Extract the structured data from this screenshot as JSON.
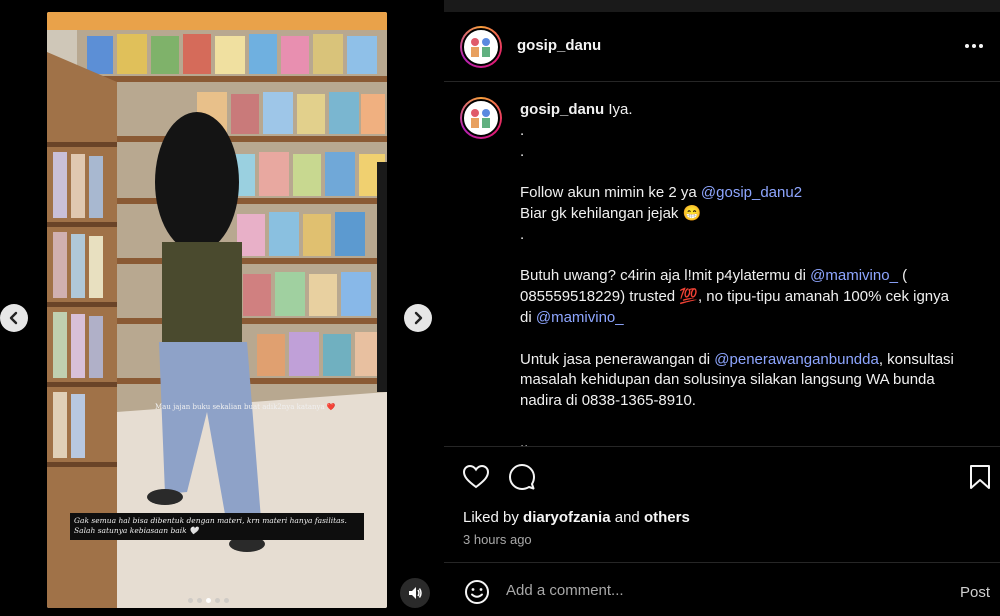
{
  "post": {
    "username": "gosip_danu",
    "more_icon": "more-horizontal-icon",
    "caption": {
      "username": "gosip_danu",
      "lines": [
        {
          "parts": [
            {
              "text": " Iya."
            }
          ]
        },
        {
          "parts": [
            {
              "text": "."
            }
          ]
        },
        {
          "parts": [
            {
              "text": "."
            }
          ]
        },
        {
          "parts": [
            {
              "text": ""
            }
          ]
        },
        {
          "parts": [
            {
              "text": "Follow akun mimin ke 2 ya "
            },
            {
              "text": "@gosip_danu2",
              "mention": true
            }
          ]
        },
        {
          "parts": [
            {
              "text": "Biar gk kehilangan jejak 😁"
            }
          ]
        },
        {
          "parts": [
            {
              "text": "."
            }
          ]
        },
        {
          "parts": [
            {
              "text": ""
            }
          ]
        },
        {
          "parts": [
            {
              "text": "Butuh uwang? c4irin aja l!mit p4ylatermu di "
            },
            {
              "text": "@mamivino_",
              "mention": true
            },
            {
              "text": " ("
            }
          ]
        },
        {
          "parts": [
            {
              "text": "085559518229) trusted 💯, no tipu-tipu amanah 100% cek ignya"
            }
          ]
        },
        {
          "parts": [
            {
              "text": "di "
            },
            {
              "text": "@mamivino_",
              "mention": true
            }
          ]
        },
        {
          "parts": [
            {
              "text": ""
            }
          ]
        },
        {
          "parts": [
            {
              "text": "Untuk jasa penerawangan di "
            },
            {
              "text": "@penerawanganbundda",
              "mention": true
            },
            {
              "text": ", konsultasi"
            }
          ]
        },
        {
          "parts": [
            {
              "text": "masalah kehidupan dan solusinya silakan langsung WA bunda"
            }
          ]
        },
        {
          "parts": [
            {
              "text": "nadira di 0838-1365-8910."
            }
          ]
        },
        {
          "parts": [
            {
              "text": ""
            }
          ]
        },
        {
          "parts": [
            {
              "text": ".."
            }
          ]
        }
      ]
    },
    "likes": {
      "prefix": "Liked by ",
      "user": "diaryofzania",
      "middle": " and ",
      "others": "others"
    },
    "timestamp": "3 hours ago",
    "comment": {
      "placeholder": "Add a comment...",
      "post_label": "Post"
    }
  },
  "media": {
    "overlay_text": "Mau jajan buku sekalian buat adik2nya katanya ❤️",
    "quote_lines": [
      "Gak semua hal bisa dibentuk dengan materi, krn materi hanya fasilitas.",
      "Salah satunya kebiasaan baik 🤍"
    ],
    "slide_count": 5,
    "active_slide": 2
  },
  "icons": {
    "prev": "chevron-left-icon",
    "next": "chevron-right-icon",
    "audio": "speaker-icon",
    "like": "heart-icon",
    "comment": "comment-bubble-icon",
    "save": "bookmark-icon",
    "emoji": "emoji-icon"
  },
  "colors": {
    "mention": "#8ea6ff",
    "background": "#000000"
  }
}
